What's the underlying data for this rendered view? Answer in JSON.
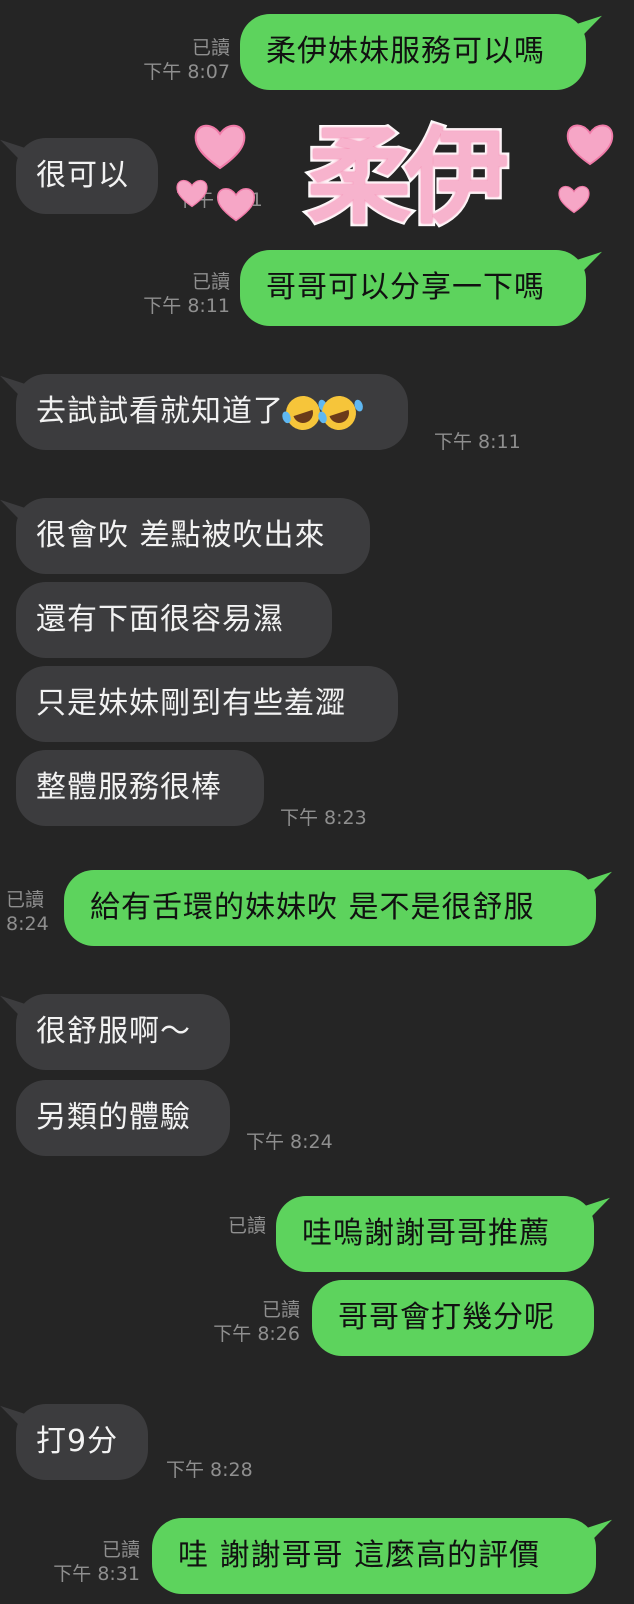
{
  "messages": [
    {
      "id": "m1",
      "side": "sent",
      "text": "柔伊妹妹服務可以嗎",
      "read": "已讀",
      "time": "下午 8:07"
    },
    {
      "id": "m2",
      "side": "recv",
      "text": "很可以",
      "time": "下午 8:11"
    },
    {
      "id": "sticker",
      "side": "sent",
      "text": "柔伊",
      "kind": "sticker"
    },
    {
      "id": "m3",
      "side": "sent",
      "text": "哥哥可以分享一下嗎",
      "read": "已讀",
      "time": "下午 8:11"
    },
    {
      "id": "m4",
      "side": "recv",
      "text": "去試試看就知道了",
      "emoji": "rolling-on-floor-laughing x2",
      "time": "下午 8:11"
    },
    {
      "id": "m5",
      "side": "recv",
      "text": "很會吹 差點被吹出來"
    },
    {
      "id": "m6",
      "side": "recv",
      "text": "還有下面很容易濕"
    },
    {
      "id": "m7",
      "side": "recv",
      "text": "只是妹妹剛到有些羞澀"
    },
    {
      "id": "m8",
      "side": "recv",
      "text": "整體服務很棒",
      "time": "下午 8:23"
    },
    {
      "id": "m9",
      "side": "sent",
      "text": "給有舌環的妹妹吹 是不是很舒服",
      "read": "已讀",
      "time": "8:24"
    },
    {
      "id": "m10",
      "side": "recv",
      "text": "很舒服啊～"
    },
    {
      "id": "m11",
      "side": "recv",
      "text": "另類的體驗",
      "time": "下午 8:24"
    },
    {
      "id": "m12",
      "side": "sent",
      "text": "哇嗚謝謝哥哥推薦",
      "read": "已讀"
    },
    {
      "id": "m13",
      "side": "sent",
      "text": "哥哥會打幾分呢",
      "read": "已讀",
      "time": "下午 8:26"
    },
    {
      "id": "m14",
      "side": "recv",
      "text": "打9分",
      "time": "下午 8:28"
    },
    {
      "id": "m15",
      "side": "sent",
      "text": "哇 謝謝哥哥 這麼高的評價",
      "read": "已讀",
      "time": "下午 8:31"
    }
  ],
  "colors": {
    "background": "#252525",
    "sent_bubble": "#5dd35d",
    "received_bubble": "#3c3c3e",
    "meta_text": "#8f8f8f",
    "sticker_pink": "#f7b3cd"
  }
}
